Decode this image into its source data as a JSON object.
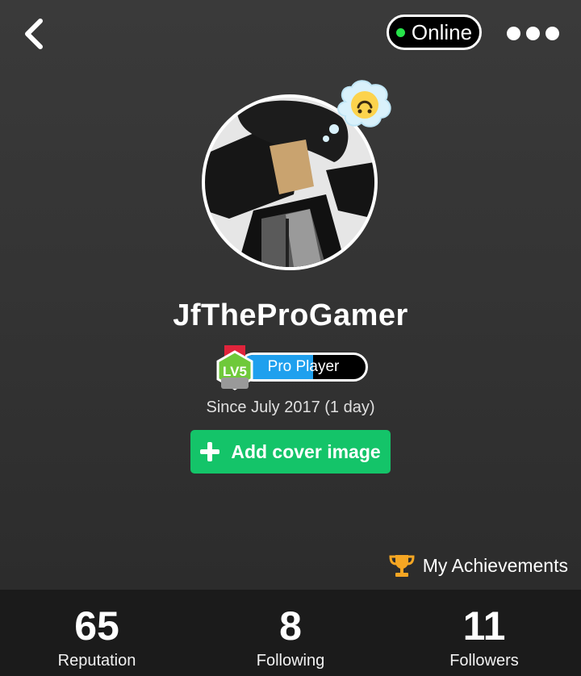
{
  "header": {
    "back_icon": "chevron-left-icon",
    "status_label": "Online",
    "status_color": "#27e34a",
    "more_icon": "more-dots-icon"
  },
  "profile": {
    "avatar_alt": "profile-avatar",
    "mood_icon": "upside-down-smile-icon",
    "username": "JfTheProGamer",
    "level_badge": "LV5",
    "title": "Pro Player",
    "title_progress": 0.58,
    "title_color": "#1fa0ee",
    "since": "Since July 2017 (1 day)",
    "cover_button": "Add cover image",
    "cover_button_color": "#14c469"
  },
  "achievements": {
    "icon": "trophy-icon",
    "label": "My Achievements",
    "icon_color": "#f5a623"
  },
  "stats": [
    {
      "value": "65",
      "label": "Reputation"
    },
    {
      "value": "8",
      "label": "Following"
    },
    {
      "value": "11",
      "label": "Followers"
    }
  ]
}
